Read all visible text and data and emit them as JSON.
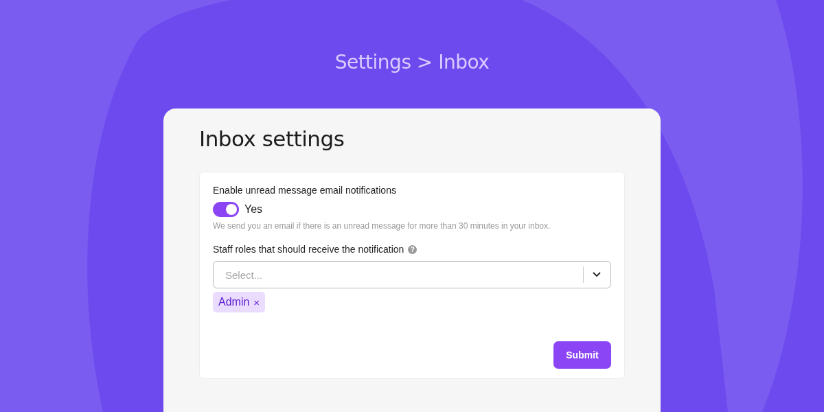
{
  "breadcrumb": "Settings > Inbox",
  "card": {
    "title": "Inbox settings"
  },
  "notifications": {
    "label": "Enable unread message email notifications",
    "toggle": {
      "on": true,
      "label": "Yes"
    },
    "hint": "We send you an email if there is an unread message for more than 30 minutes in your inbox."
  },
  "roles": {
    "label": "Staff roles that should receive the notification",
    "help_icon": "?",
    "select": {
      "placeholder": "Select..."
    },
    "tags": [
      {
        "label": "Admin",
        "remove": "×"
      }
    ]
  },
  "buttons": [
    {
      "label": "Submit"
    }
  ]
}
